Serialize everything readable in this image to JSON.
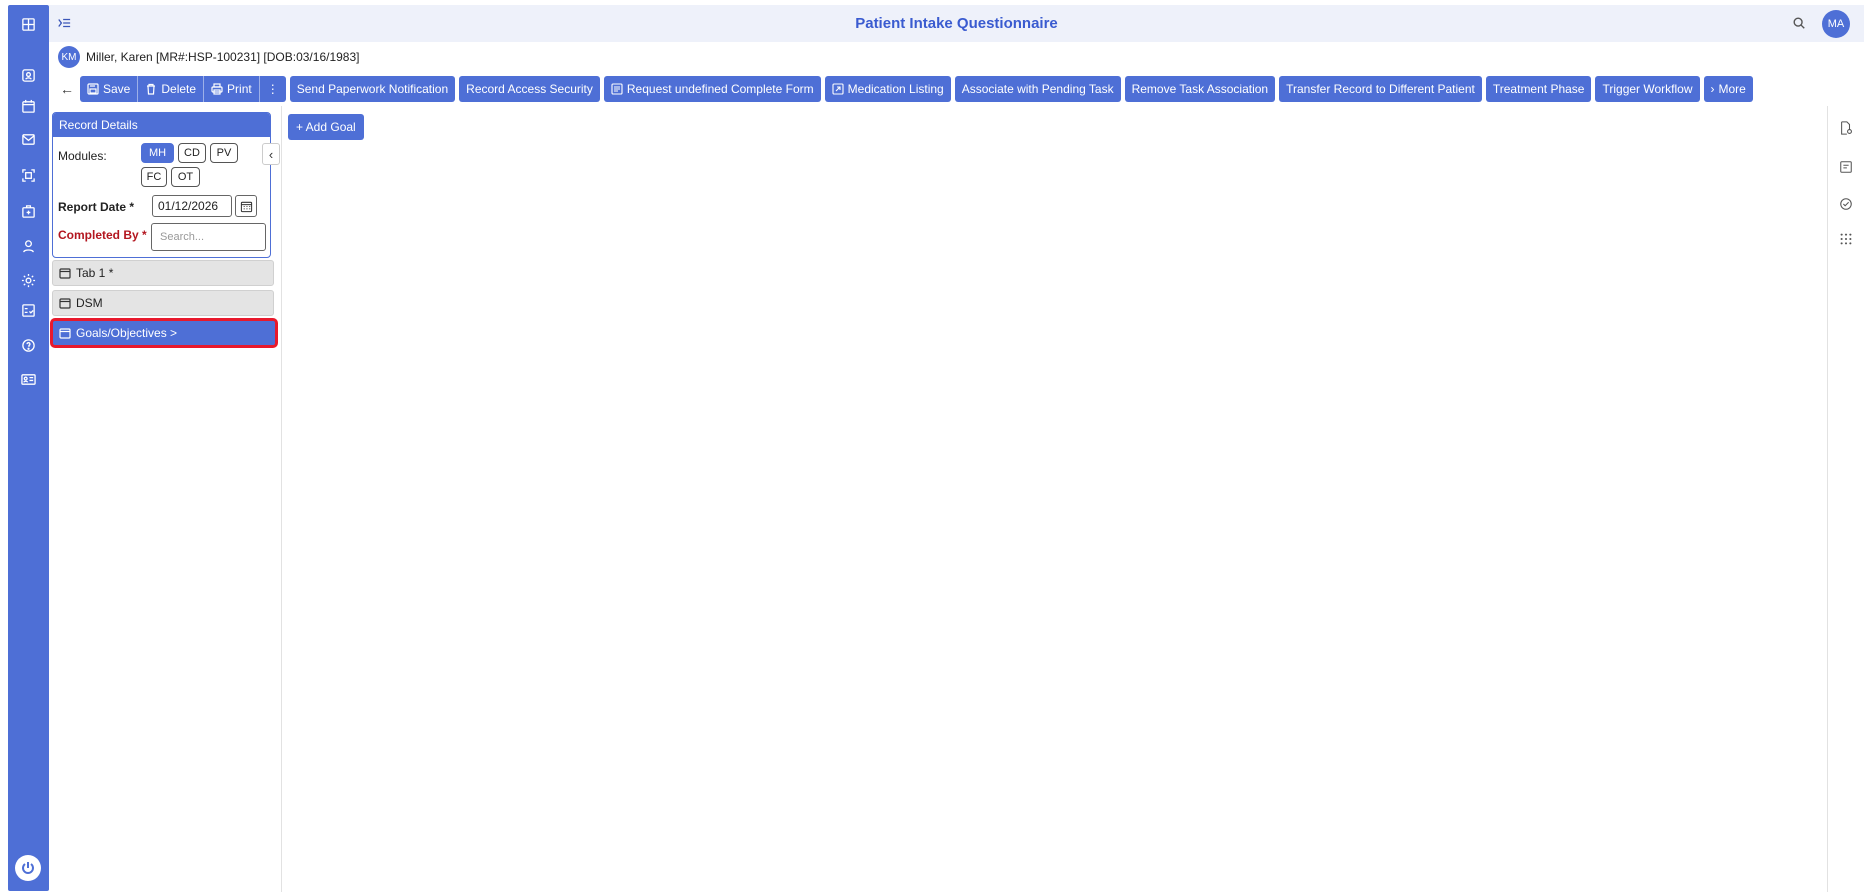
{
  "app": {
    "title": "Patient Intake Questionnaire",
    "user_initials": "MA"
  },
  "patient": {
    "initials": "KM",
    "label": "Miller, Karen [MR#:HSP-100231] [DOB:03/16/1983]"
  },
  "toolbar": {
    "save": "Save",
    "delete": "Delete",
    "print": "Print",
    "more_dots": "⋮",
    "send_paperwork": "Send Paperwork Notification",
    "record_access": "Record Access Security",
    "request_form": "Request undefined Complete Form",
    "medication": "Medication Listing",
    "associate_task": "Associate with Pending Task",
    "remove_task": "Remove Task Association",
    "transfer": "Transfer Record to Different Patient",
    "treatment_phase": "Treatment Phase",
    "trigger_workflow": "Trigger Workflow",
    "more": "More"
  },
  "record_details": {
    "header": "Record Details",
    "modules_label": "Modules:",
    "modules": [
      "MH",
      "CD",
      "PV",
      "FC",
      "OT"
    ],
    "active_module": "MH",
    "report_date_label": "Report Date *",
    "report_date_value": "01/12/2026",
    "completed_by_label": "Completed By *",
    "completed_by_placeholder": "Search..."
  },
  "tabs": [
    {
      "label": "Tab 1 *"
    },
    {
      "label": "DSM"
    },
    {
      "label": "Goals/Objectives >"
    }
  ],
  "main": {
    "add_goal": "+ Add Goal"
  },
  "colors": {
    "primary": "#4e6fd6",
    "highlight": "#e8192c",
    "required_label": "#b3161f"
  }
}
